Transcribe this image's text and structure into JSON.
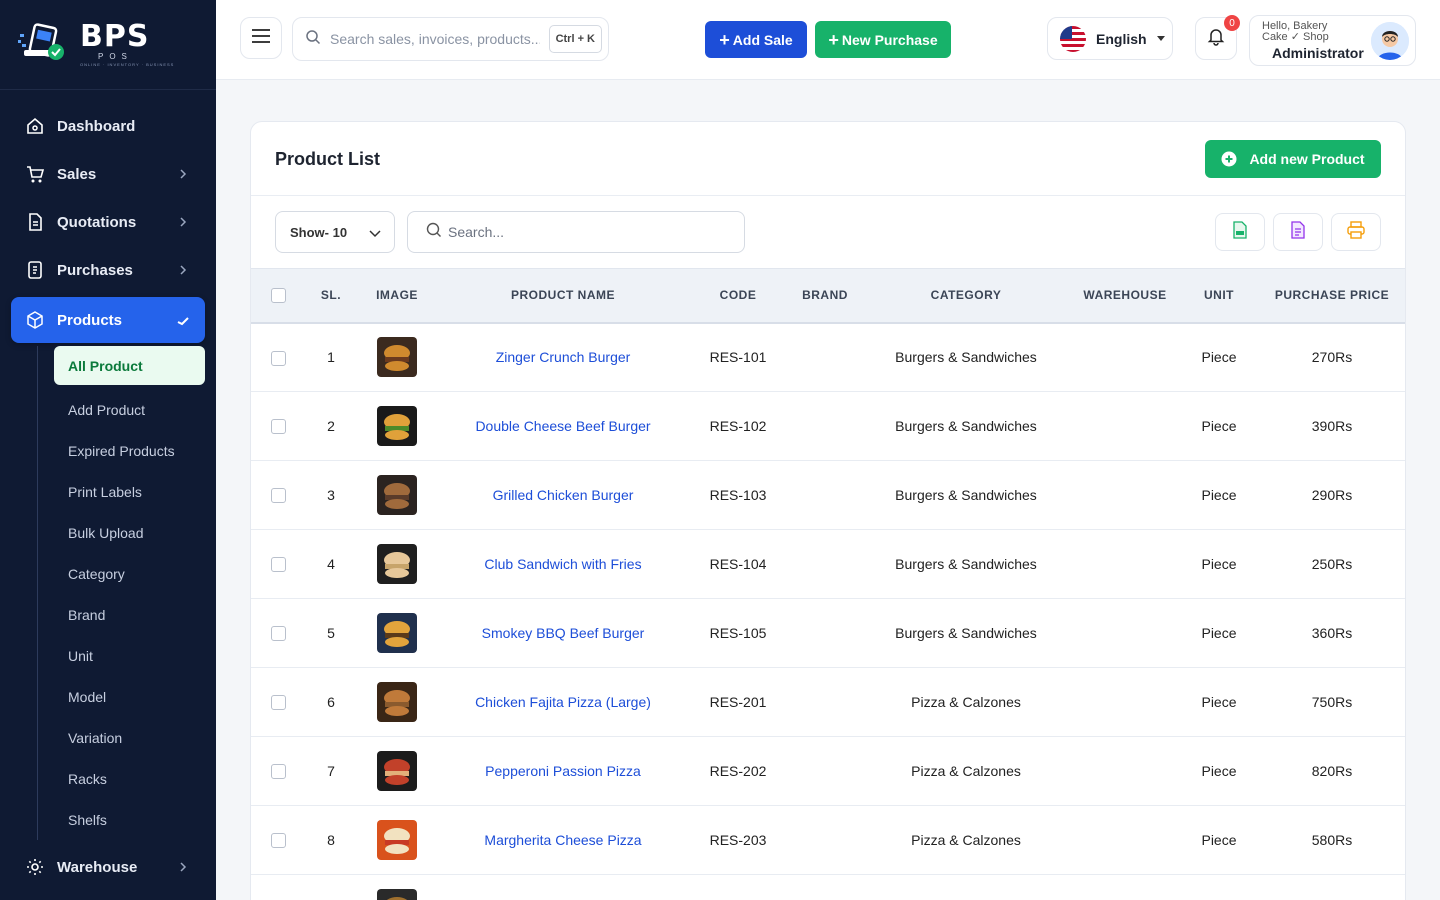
{
  "brand": {
    "name": "BPS",
    "sub": "POS",
    "tagline": "ONLINE · INVENTORY · BUSINESS"
  },
  "sidebar": {
    "items": [
      {
        "label": "Dashboard",
        "icon": "home-icon"
      },
      {
        "label": "Sales",
        "icon": "cart-icon"
      },
      {
        "label": "Quotations",
        "icon": "document-icon"
      },
      {
        "label": "Purchases",
        "icon": "receipt-icon"
      },
      {
        "label": "Products",
        "icon": "box-icon"
      }
    ],
    "products_sub": [
      "All Product",
      "Add Product",
      "Expired Products",
      "Print Labels",
      "Bulk Upload",
      "Category",
      "Brand",
      "Unit",
      "Model",
      "Variation",
      "Racks",
      "Shelfs"
    ],
    "bottom": {
      "label": "Warehouse",
      "icon": "gear-icon"
    }
  },
  "topbar": {
    "search_placeholder": "Search sales, invoices, products...",
    "shortcut": "Ctrl + K",
    "add_sale": "Add Sale",
    "new_purchase": "New Purchase",
    "language": "English",
    "notifications": "0",
    "greeting": "Hello, Bakery Cake ✓ Shop",
    "role": "Administrator"
  },
  "colors": {
    "sidebar": "#0f1a33",
    "primary": "#2563eb",
    "success": "#17b26a",
    "link": "#1d4ed8"
  },
  "page": {
    "title": "Product List",
    "add_button": "Add new Product",
    "show": "Show- 10",
    "search_placeholder": "Search...",
    "columns": [
      "SL.",
      "IMAGE",
      "PRODUCT NAME",
      "CODE",
      "BRAND",
      "CATEGORY",
      "WAREHOUSE",
      "UNIT",
      "PURCHASE PRICE"
    ],
    "rows": [
      {
        "sl": "1",
        "name": "Zinger Crunch Burger",
        "code": "RES-101",
        "brand": "",
        "category": "Burgers & Sandwiches",
        "warehouse": "",
        "unit": "Piece",
        "price": "270Rs"
      },
      {
        "sl": "2",
        "name": "Double Cheese Beef Burger",
        "code": "RES-102",
        "brand": "",
        "category": "Burgers & Sandwiches",
        "warehouse": "",
        "unit": "Piece",
        "price": "390Rs"
      },
      {
        "sl": "3",
        "name": "Grilled Chicken Burger",
        "code": "RES-103",
        "brand": "",
        "category": "Burgers & Sandwiches",
        "warehouse": "",
        "unit": "Piece",
        "price": "290Rs"
      },
      {
        "sl": "4",
        "name": "Club Sandwich with Fries",
        "code": "RES-104",
        "brand": "",
        "category": "Burgers & Sandwiches",
        "warehouse": "",
        "unit": "Piece",
        "price": "250Rs"
      },
      {
        "sl": "5",
        "name": "Smokey BBQ Beef Burger",
        "code": "RES-105",
        "brand": "",
        "category": "Burgers & Sandwiches",
        "warehouse": "",
        "unit": "Piece",
        "price": "360Rs"
      },
      {
        "sl": "6",
        "name": "Chicken Fajita Pizza (Large)",
        "code": "RES-201",
        "brand": "",
        "category": "Pizza & Calzones",
        "warehouse": "",
        "unit": "Piece",
        "price": "750Rs"
      },
      {
        "sl": "7",
        "name": "Pepperoni Passion Pizza",
        "code": "RES-202",
        "brand": "",
        "category": "Pizza & Calzones",
        "warehouse": "",
        "unit": "Piece",
        "price": "820Rs"
      },
      {
        "sl": "8",
        "name": "Margherita Cheese Pizza",
        "code": "RES-203",
        "brand": "",
        "category": "Pizza & Calzones",
        "warehouse": "",
        "unit": "Piece",
        "price": "580Rs"
      },
      {
        "sl": "",
        "name": "",
        "code": "",
        "brand": "",
        "category": "",
        "warehouse": "",
        "unit": "",
        "price": ""
      }
    ]
  }
}
